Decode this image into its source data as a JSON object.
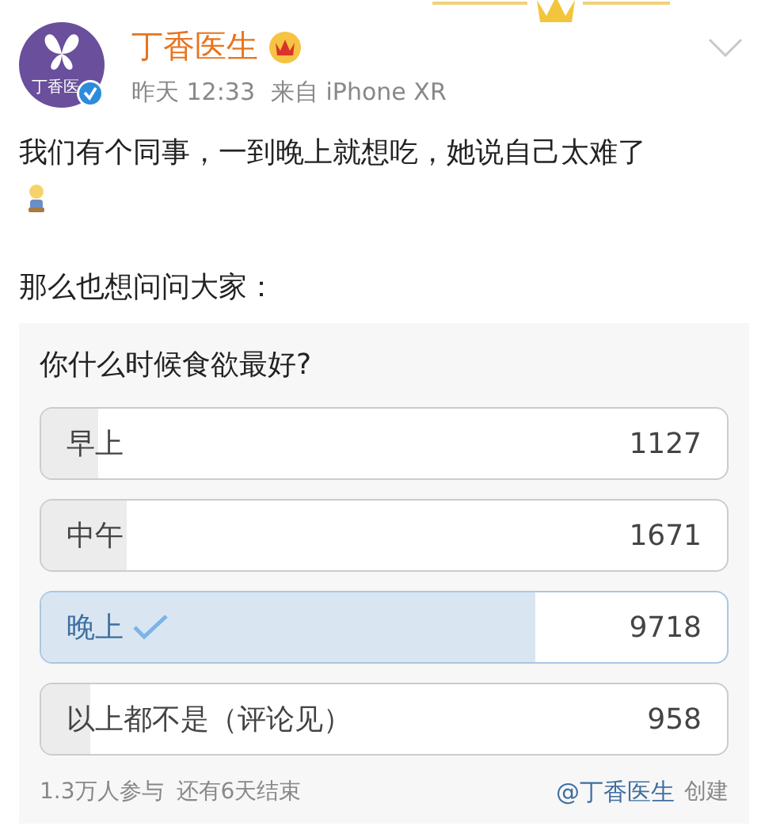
{
  "post": {
    "author": "丁香医生",
    "avatar_text": "丁香医",
    "verified": true,
    "time": "昨天 12:33",
    "source": "来自 iPhone XR",
    "text": "我们有个同事，一到晚上就想吃，她说自己太难了",
    "text2": "那么也想问问大家："
  },
  "poll": {
    "question": "你什么时候食欲最好?",
    "options": [
      {
        "label": "早上",
        "count": "1127",
        "level": 0.084,
        "selected": false
      },
      {
        "label": "中午",
        "count": "1671",
        "level": 0.124,
        "selected": false
      },
      {
        "label": "晚上",
        "count": "9718",
        "level": 0.721,
        "selected": true
      },
      {
        "label": "以上都不是（评论见）",
        "count": "958",
        "level": 0.071,
        "selected": false
      }
    ],
    "participants": "1.3万人参与",
    "remaining": "还有6天结束",
    "creator": "@丁香医生",
    "created": "创建"
  }
}
